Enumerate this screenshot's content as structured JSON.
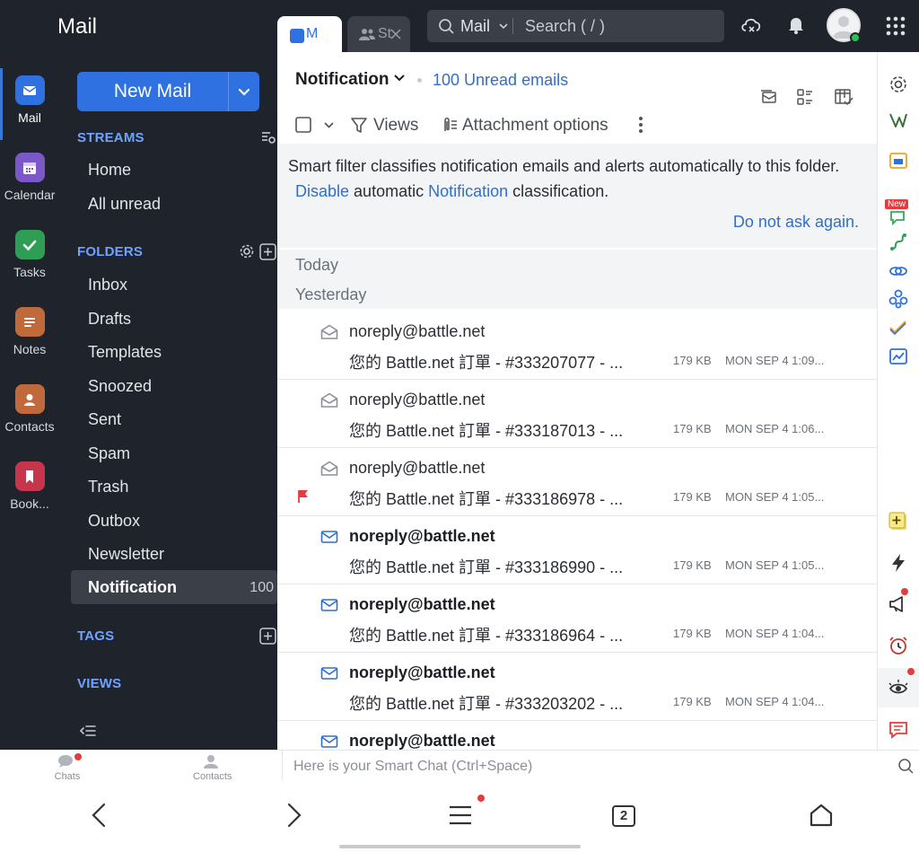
{
  "app": {
    "name": "Mail",
    "logo_icon": "mail-logo-icon"
  },
  "rail": [
    {
      "label": "Mail",
      "icon": "mail-icon",
      "color": "#2f71e0"
    },
    {
      "label": "Calendar",
      "icon": "calendar-icon",
      "color": "#7b57c8"
    },
    {
      "label": "Tasks",
      "icon": "tasks-icon",
      "color": "#2f9e55"
    },
    {
      "label": "Notes",
      "icon": "notes-icon",
      "color": "#c0693a"
    },
    {
      "label": "Contacts",
      "icon": "contacts-icon",
      "color": "#c0693a"
    },
    {
      "label": "Book...",
      "icon": "bookmark-icon",
      "color": "#c7354d"
    }
  ],
  "sidebar": {
    "new_mail": "New Mail",
    "streams_label": "STREAMS",
    "streams": [
      "Home",
      "All unread"
    ],
    "folders_label": "FOLDERS",
    "folders": [
      "Inbox",
      "Drafts",
      "Templates",
      "Snoozed",
      "Sent",
      "Spam",
      "Trash",
      "Outbox",
      "Newsletter"
    ],
    "active_folder": {
      "label": "Notification",
      "count": "100"
    },
    "tags_label": "TAGS",
    "views_label": "VIEWS"
  },
  "topbar": {
    "tab1_label": "M",
    "tab2_label": "St",
    "search_scope": "Mail",
    "search_placeholder": "Search ( / )"
  },
  "main": {
    "folder_title": "Notification",
    "unread_link": "100 Unread emails",
    "toolbar": {
      "views": "Views",
      "attachment_options": "Attachment options"
    },
    "info": {
      "line1": "Smart filter classifies notification emails and alerts automatically to this folder.",
      "disable": "Disable",
      "automatic": "automatic",
      "notification": "Notification",
      "classification": "classification.",
      "dont_ask": "Do not ask again."
    },
    "groups": {
      "today": "Today",
      "yesterday": "Yesterday"
    },
    "emails": [
      {
        "from": "noreply@battle.net",
        "subject": "您的 Battle.net 訂單 - #333207077 - ...",
        "size": "179 KB",
        "date": "MON SEP 4 1:09...",
        "unread": false,
        "flagged": false
      },
      {
        "from": "noreply@battle.net",
        "subject": "您的 Battle.net 訂單 - #333187013 - ...",
        "size": "179 KB",
        "date": "MON SEP 4 1:06...",
        "unread": false,
        "flagged": false
      },
      {
        "from": "noreply@battle.net",
        "subject": "您的 Battle.net 訂單 - #333186978 - ...",
        "size": "179 KB",
        "date": "MON SEP 4 1:05...",
        "unread": false,
        "flagged": true
      },
      {
        "from": "noreply@battle.net",
        "subject": "您的 Battle.net 訂單 - #333186990 - ...",
        "size": "179 KB",
        "date": "MON SEP 4 1:05...",
        "unread": true,
        "flagged": false
      },
      {
        "from": "noreply@battle.net",
        "subject": "您的 Battle.net 訂單 - #333186964 - ...",
        "size": "179 KB",
        "date": "MON SEP 4 1:04...",
        "unread": true,
        "flagged": false
      },
      {
        "from": "noreply@battle.net",
        "subject": "您的 Battle.net 訂單 - #333203202 - ...",
        "size": "179 KB",
        "date": "MON SEP 4 1:04...",
        "unread": true,
        "flagged": false
      },
      {
        "from": "noreply@battle.net",
        "subject": "",
        "size": "",
        "date": "",
        "unread": true,
        "flagged": false
      }
    ]
  },
  "toolrail": {
    "new_badge": "New"
  },
  "bottombar": {
    "chats": "Chats",
    "contacts": "Contacts",
    "smart_chat_placeholder": "Here is your Smart Chat (Ctrl+Space)"
  },
  "androidnav": {
    "tabs_count": "2"
  },
  "colors": {
    "dark": "#1f232b",
    "accent": "#2f71e0",
    "link": "#2f6fcc",
    "flag": "#e23c3c"
  }
}
